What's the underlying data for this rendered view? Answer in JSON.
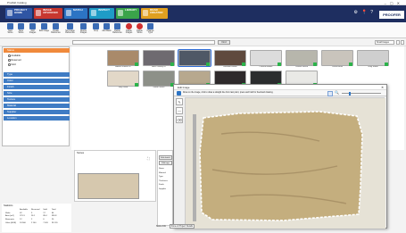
{
  "app": {
    "title": "Prodlab Catalog"
  },
  "nav": {
    "buttons": [
      {
        "label": "PROJECT HOME",
        "color": "#2f55a4"
      },
      {
        "label": "IMAGE ADVANCED",
        "color": "#c7372f"
      },
      {
        "label": "MATCH",
        "color": "#2c74c4"
      },
      {
        "label": "INSPECT",
        "color": "#1e9cc7"
      },
      {
        "label": "LIBRARY",
        "color": "#3aa44a"
      },
      {
        "label": "ROAD CREATOR",
        "color": "#e0a020"
      }
    ],
    "icons": [
      "gear-icon",
      "pin-icon",
      "help-icon"
    ],
    "logo": "PROOFER"
  },
  "toolbar": {
    "buttons": [
      {
        "label": "New Stone",
        "color": "#3a6bb5"
      },
      {
        "label": "Save Stone",
        "color": "#3a6bb5"
      },
      {
        "label": "Add Images",
        "color": "#3a6bb5"
      },
      {
        "label": "Edit Image",
        "color": "#3a6bb5"
      },
      {
        "label": "Create Reference",
        "color": "#3a6bb5"
      },
      {
        "label": "Set Image Reference",
        "color": "#3a6bb5"
      },
      {
        "label": "Resize Images",
        "color": "#3a6bb5"
      },
      {
        "label": "Crop",
        "color": "#3a6bb5"
      },
      {
        "label": "Add Mask",
        "color": "#3a6bb5"
      },
      {
        "label": "Delete Reference",
        "color": "#3a6bb5"
      },
      {
        "label": "Delete Images",
        "color": "#d03030"
      },
      {
        "label": "Delete Stone",
        "color": "#d03030"
      },
      {
        "label": "Change Type",
        "color": "#3a6bb5"
      }
    ]
  },
  "filter": {
    "button": "Find",
    "view_label": "Small Images"
  },
  "sidebar": {
    "sections": [
      {
        "label": "Status",
        "selected": true
      },
      {
        "label": "Type"
      },
      {
        "label": "Color"
      },
      {
        "label": "Finish"
      },
      {
        "label": "Size"
      },
      {
        "label": "Texture"
      },
      {
        "label": "Material"
      },
      {
        "label": "Supplier"
      },
      {
        "label": "Location"
      }
    ],
    "radios": [
      "Available",
      "Reserved",
      "Sold"
    ]
  },
  "gallery": {
    "items": [
      {
        "caption": "Amber Granite 01",
        "color": "#a98a6a"
      },
      {
        "caption": "Black Galaxy 02",
        "color": "#6e6a70"
      },
      {
        "caption": "Blue Pearl 03",
        "color": "#4f5866",
        "selected": true
      },
      {
        "caption": "Brazilian Brown",
        "color": "#5f4a3e"
      },
      {
        "caption": "Cararra Marble",
        "color": "#dcdcdc"
      },
      {
        "caption": "Coastal Green",
        "color": "#b7b6ac"
      },
      {
        "caption": "Crema Bella",
        "color": "#c9c4bc"
      },
      {
        "caption": "Grey Storm",
        "color": "#cfcfcf"
      },
      {
        "caption": "Ivory Sand",
        "color": "#e2d8c8"
      },
      {
        "caption": "Indian Green",
        "color": "#8d9088"
      },
      {
        "caption": "Kashmir Gold",
        "color": "#b7a88e"
      },
      {
        "caption": "Paradiso",
        "color": "#2e2a2c"
      },
      {
        "caption": "Ubatuba",
        "color": "#2b2d2e"
      },
      {
        "caption": "White Onyx",
        "color": "#e9e9e6"
      }
    ]
  },
  "detail": {
    "title": "Stones",
    "fields": [
      "Name",
      "Material",
      "Type",
      "Thickness",
      "Finish",
      "Supplier"
    ],
    "buttons": [
      "Edit details",
      "Edit tags"
    ],
    "thumb_color": "#d6c8ae"
  },
  "stats": {
    "title": "Statistics",
    "headers": [
      "",
      "Available",
      "Reserved",
      "Sold",
      "Total"
    ],
    "rows": [
      [
        "Slabs",
        "42",
        "5",
        "17",
        "64"
      ],
      [
        "Area (m2)",
        "221.3",
        "26.1",
        "89.4",
        "336.8"
      ],
      [
        "Remnants",
        "12",
        "2",
        "6",
        "20"
      ],
      [
        "Value (EUR)",
        "18 560",
        "2 140",
        "7 420",
        "28 120"
      ]
    ]
  },
  "editor": {
    "title": "Edit Image",
    "hint": "Draw on the image, click to draw a straight line from last point, press and hold for freehand drawing.",
    "canvas_bg": "#e6e2d6",
    "slab_color": "#c4ae7e"
  },
  "bottom": {
    "tabs": [
      "Stone Info",
      "Stone & Project Details"
    ]
  }
}
